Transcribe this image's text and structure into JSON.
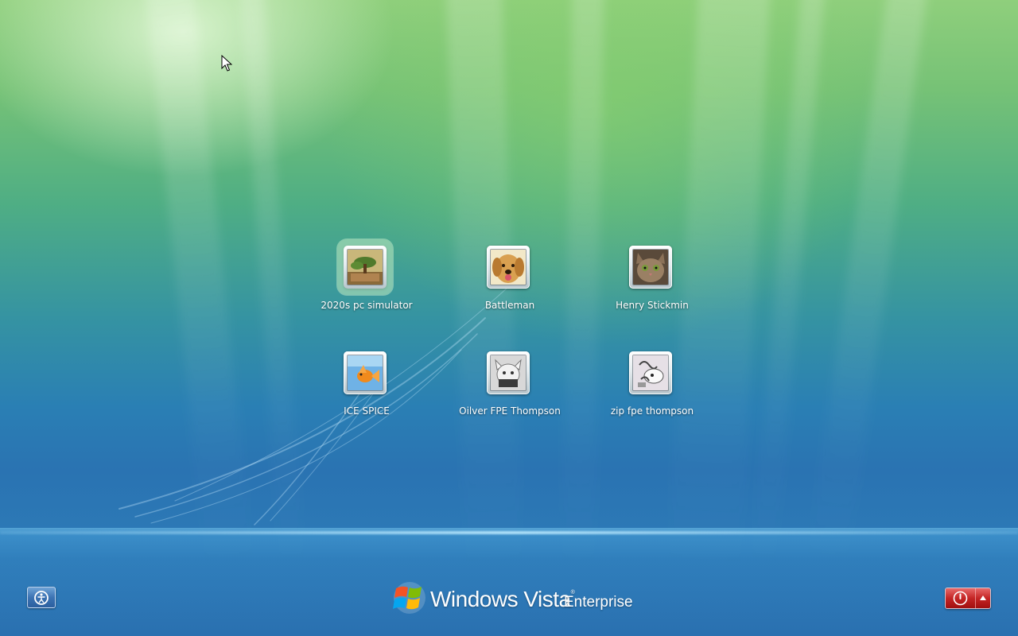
{
  "users": [
    {
      "name": "2020s pc simulator",
      "picture": "bonsai-tree-picture",
      "focused": true
    },
    {
      "name": "Battleman",
      "picture": "dog-picture",
      "focused": false
    },
    {
      "name": "Henry Stickmin",
      "picture": "kitten-picture",
      "focused": false
    },
    {
      "name": "ICE SPICE",
      "picture": "goldfish-picture",
      "focused": false
    },
    {
      "name": "Oilver FPE Thompson",
      "picture": "sketch-picture",
      "focused": false
    },
    {
      "name": "zip fpe thompson",
      "picture": "sketch-picture",
      "focused": false
    }
  ],
  "branding": {
    "windows": "Windows",
    "vista": "Vista",
    "tm": "®",
    "edition": "Enterprise"
  },
  "controls": {
    "ease_of_access_icon": "ease-of-access-icon",
    "shutdown_icon": "power-icon",
    "shutdown_options_icon": "chevron-up-icon"
  },
  "colors": {
    "shutdown_red": "#c42525",
    "ease_blue": "#3c73b3"
  }
}
